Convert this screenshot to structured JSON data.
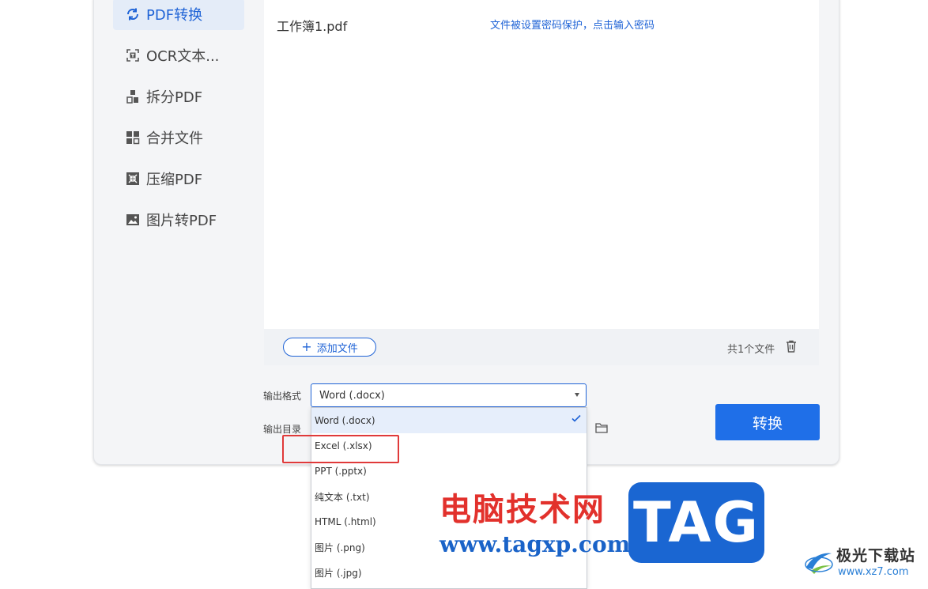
{
  "sidebar": {
    "items": [
      {
        "label": "PDF转换",
        "icon": "refresh-icon",
        "active": true
      },
      {
        "label": "OCR文本...",
        "icon": "ocr-scan-icon",
        "active": false
      },
      {
        "label": "拆分PDF",
        "icon": "split-icon",
        "active": false
      },
      {
        "label": "合并文件",
        "icon": "merge-icon",
        "active": false
      },
      {
        "label": "压缩PDF",
        "icon": "compress-icon",
        "active": false
      },
      {
        "label": "图片转PDF",
        "icon": "image-icon",
        "active": false
      }
    ]
  },
  "file_list": {
    "files": [
      {
        "name": "工作簿1.pdf",
        "status": "文件被设置密码保护，点击输入密码"
      }
    ]
  },
  "footer": {
    "add_label": "添加文件",
    "count_label": "共1个文件"
  },
  "output": {
    "format_label": "输出格式",
    "dir_label": "输出目录",
    "selected_format": "Word (.docx)",
    "options": [
      "Word (.docx)",
      "Excel (.xlsx)",
      "PPT (.pptx)",
      "纯文本 (.txt)",
      "HTML (.html)",
      "图片 (.png)",
      "图片 (.jpg)"
    ]
  },
  "convert_label": "转换",
  "watermark": {
    "site_cn": "电脑技术网",
    "site_url": "www.tagxp.com",
    "tag": "TAG",
    "brand_cn": "极光下载站",
    "brand_url": "www.xz7.com"
  },
  "colors": {
    "accent": "#1f63d6",
    "button": "#1f6fe8",
    "highlight": "#e03a3a"
  }
}
